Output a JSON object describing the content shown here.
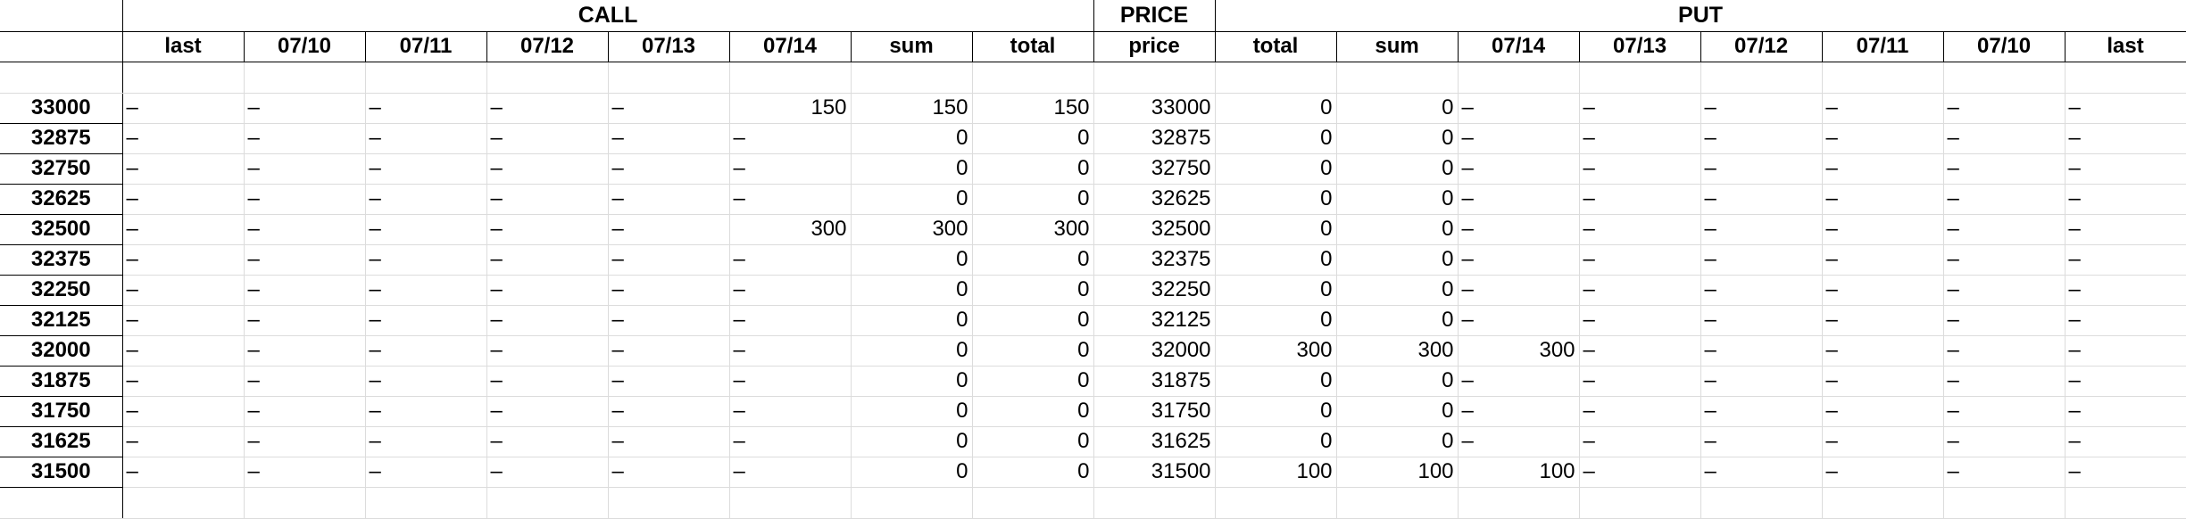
{
  "groups": {
    "call": "CALL",
    "price": "PRICE",
    "put": "PUT"
  },
  "call_headers": [
    "last",
    "07/10",
    "07/11",
    "07/12",
    "07/13",
    "07/14",
    "sum",
    "total"
  ],
  "price_header": "price",
  "put_headers": [
    "total",
    "sum",
    "07/14",
    "07/13",
    "07/12",
    "07/11",
    "07/10",
    "last"
  ],
  "rows": [
    {
      "strike": "33000",
      "call": [
        "–",
        "–",
        "–",
        "–",
        "–",
        "150",
        "150",
        "150"
      ],
      "price": "33000",
      "put": [
        "0",
        "0",
        "–",
        "–",
        "–",
        "–",
        "–",
        "–"
      ]
    },
    {
      "strike": "32875",
      "call": [
        "–",
        "–",
        "–",
        "–",
        "–",
        "–",
        "0",
        "0"
      ],
      "price": "32875",
      "put": [
        "0",
        "0",
        "–",
        "–",
        "–",
        "–",
        "–",
        "–"
      ]
    },
    {
      "strike": "32750",
      "call": [
        "–",
        "–",
        "–",
        "–",
        "–",
        "–",
        "0",
        "0"
      ],
      "price": "32750",
      "put": [
        "0",
        "0",
        "–",
        "–",
        "–",
        "–",
        "–",
        "–"
      ]
    },
    {
      "strike": "32625",
      "call": [
        "–",
        "–",
        "–",
        "–",
        "–",
        "–",
        "0",
        "0"
      ],
      "price": "32625",
      "put": [
        "0",
        "0",
        "–",
        "–",
        "–",
        "–",
        "–",
        "–"
      ]
    },
    {
      "strike": "32500",
      "call": [
        "–",
        "–",
        "–",
        "–",
        "–",
        "300",
        "300",
        "300"
      ],
      "price": "32500",
      "put": [
        "0",
        "0",
        "–",
        "–",
        "–",
        "–",
        "–",
        "–"
      ]
    },
    {
      "strike": "32375",
      "call": [
        "–",
        "–",
        "–",
        "–",
        "–",
        "–",
        "0",
        "0"
      ],
      "price": "32375",
      "put": [
        "0",
        "0",
        "–",
        "–",
        "–",
        "–",
        "–",
        "–"
      ]
    },
    {
      "strike": "32250",
      "call": [
        "–",
        "–",
        "–",
        "–",
        "–",
        "–",
        "0",
        "0"
      ],
      "price": "32250",
      "put": [
        "0",
        "0",
        "–",
        "–",
        "–",
        "–",
        "–",
        "–"
      ]
    },
    {
      "strike": "32125",
      "call": [
        "–",
        "–",
        "–",
        "–",
        "–",
        "–",
        "0",
        "0"
      ],
      "price": "32125",
      "put": [
        "0",
        "0",
        "–",
        "–",
        "–",
        "–",
        "–",
        "–"
      ]
    },
    {
      "strike": "32000",
      "call": [
        "–",
        "–",
        "–",
        "–",
        "–",
        "–",
        "0",
        "0"
      ],
      "price": "32000",
      "put": [
        "300",
        "300",
        "300",
        "–",
        "–",
        "–",
        "–",
        "–"
      ]
    },
    {
      "strike": "31875",
      "call": [
        "–",
        "–",
        "–",
        "–",
        "–",
        "–",
        "0",
        "0"
      ],
      "price": "31875",
      "put": [
        "0",
        "0",
        "–",
        "–",
        "–",
        "–",
        "–",
        "–"
      ]
    },
    {
      "strike": "31750",
      "call": [
        "–",
        "–",
        "–",
        "–",
        "–",
        "–",
        "0",
        "0"
      ],
      "price": "31750",
      "put": [
        "0",
        "0",
        "–",
        "–",
        "–",
        "–",
        "–",
        "–"
      ]
    },
    {
      "strike": "31625",
      "call": [
        "–",
        "–",
        "–",
        "–",
        "–",
        "–",
        "0",
        "0"
      ],
      "price": "31625",
      "put": [
        "0",
        "0",
        "–",
        "–",
        "–",
        "–",
        "–",
        "–"
      ]
    },
    {
      "strike": "31500",
      "call": [
        "–",
        "–",
        "–",
        "–",
        "–",
        "–",
        "0",
        "0"
      ],
      "price": "31500",
      "put": [
        "100",
        "100",
        "100",
        "–",
        "–",
        "–",
        "–",
        "–"
      ]
    }
  ]
}
